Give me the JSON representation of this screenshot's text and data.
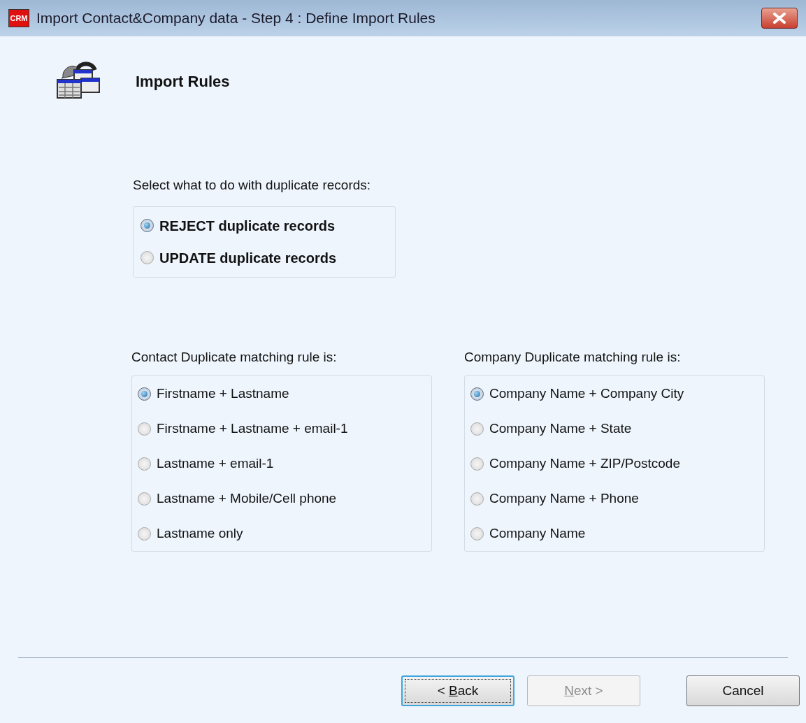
{
  "window": {
    "logo": "CRM",
    "title": "Import Contact&Company data - Step 4 : Define Import Rules"
  },
  "header": {
    "title": "Import Rules"
  },
  "duplicate_action": {
    "prompt": "Select what to do with duplicate records:",
    "options": [
      {
        "label": "REJECT duplicate records",
        "selected": true
      },
      {
        "label": "UPDATE duplicate records",
        "selected": false
      }
    ]
  },
  "contact_rule": {
    "prompt": "Contact Duplicate matching rule is:",
    "options": [
      {
        "label": "Firstname + Lastname",
        "selected": true
      },
      {
        "label": "Firstname + Lastname + email-1",
        "selected": false
      },
      {
        "label": "Lastname + email-1",
        "selected": false
      },
      {
        "label": "Lastname + Mobile/Cell phone",
        "selected": false
      },
      {
        "label": "Lastname only",
        "selected": false
      }
    ]
  },
  "company_rule": {
    "prompt": "Company Duplicate matching rule is:",
    "options": [
      {
        "label": "Company Name + Company City",
        "selected": true
      },
      {
        "label": "Company Name + State",
        "selected": false
      },
      {
        "label": "Company Name + ZIP/Postcode",
        "selected": false
      },
      {
        "label": "Company Name + Phone",
        "selected": false
      },
      {
        "label": "Company Name",
        "selected": false
      }
    ]
  },
  "buttons": [
    {
      "before": "< ",
      "key": "B",
      "after": "ack",
      "disabled": false,
      "focused": true
    },
    {
      "key": "N",
      "after": "ext >",
      "disabled": true,
      "focused": false
    },
    {
      "before": "Cancel",
      "disabled": false,
      "focused": false
    }
  ]
}
